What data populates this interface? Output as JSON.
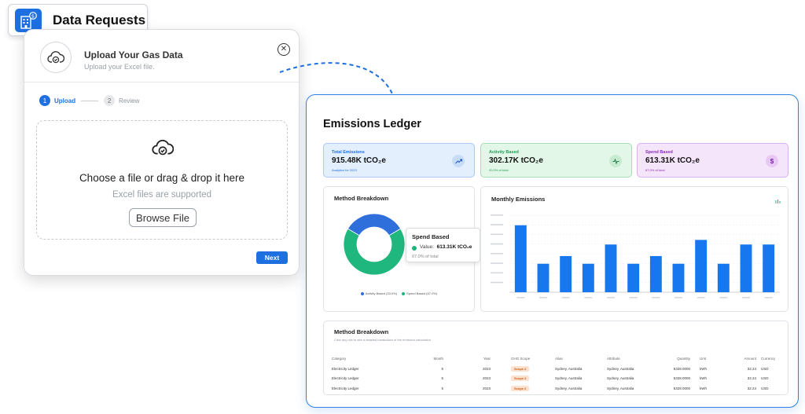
{
  "badge": {
    "title": "Data Requests"
  },
  "upload": {
    "title": "Upload Your Gas Data",
    "subtitle": "Upload your Excel file.",
    "steps": [
      {
        "num": "1",
        "label": "Upload"
      },
      {
        "num": "2",
        "label": "Review"
      }
    ],
    "dropzone_title": "Choose a file or drag & drop it here",
    "dropzone_sub": "Excel files are supported",
    "browse_label": "Browse File",
    "next_label": "Next"
  },
  "ledger": {
    "title": "Emissions Ledger",
    "kpis": [
      {
        "label": "Total Emissions",
        "value": "915.48K tCO₂e",
        "note": "Analytics for 2023",
        "color": "#1e6fe0"
      },
      {
        "label": "Activity Based",
        "value": "302.17K tCO₂e",
        "note": "33.0% of total",
        "color": "#1f9d55"
      },
      {
        "label": "Spend Based",
        "value": "613.31K tCO₂e",
        "note": "67.0% of total",
        "color": "#8a2bbd"
      }
    ],
    "method_title": "Method Breakdown",
    "tooltip": {
      "title": "Spend Based",
      "value_label": "Value:",
      "value": "613.31K tCO₂e",
      "pct": "67.0% of total"
    },
    "legend": [
      "Activity Based (33.0%)",
      "Spend Based (67.0%)"
    ],
    "monthly_title": "Monthly Emissions",
    "table": {
      "title": "Method Breakdown",
      "subtitle": "Click any row to see a detailed breakdown of the emission calculation",
      "headers": [
        "Category",
        "Month",
        "Year",
        "GHG Scope",
        "Alias",
        "Attribute",
        "Quantity",
        "Unit",
        "Amount",
        "Currency"
      ],
      "rows": [
        [
          "Electricity Ledger",
          "5",
          "2023",
          "Scope 2",
          "Sydney, Australia",
          "Sydney, Australia",
          "5328.0000",
          "kWh",
          "32.24",
          "USD"
        ],
        [
          "Electricity Ledger",
          "5",
          "2023",
          "Scope 2",
          "Sydney, Australia",
          "Sydney, Australia",
          "5328.0000",
          "kWh",
          "32.24",
          "USD"
        ],
        [
          "Electricity Ledger",
          "5",
          "2023",
          "Scope 2",
          "Sydney, Australia",
          "Sydney, Australia",
          "5328.0000",
          "kWh",
          "32.24",
          "USD"
        ]
      ]
    }
  },
  "chart_data": [
    {
      "type": "pie",
      "title": "Method Breakdown",
      "categories": [
        "Activity Based",
        "Spend Based"
      ],
      "values": [
        33.0,
        67.0
      ],
      "colors": [
        "#2f6fdc",
        "#1fb77d"
      ]
    },
    {
      "type": "bar",
      "title": "Monthly Emissions",
      "values": [
        87,
        37,
        47,
        37,
        62,
        37,
        47,
        37,
        68,
        37,
        62,
        62
      ],
      "ylim": [
        0,
        100
      ],
      "color": "#1677ee"
    }
  ]
}
